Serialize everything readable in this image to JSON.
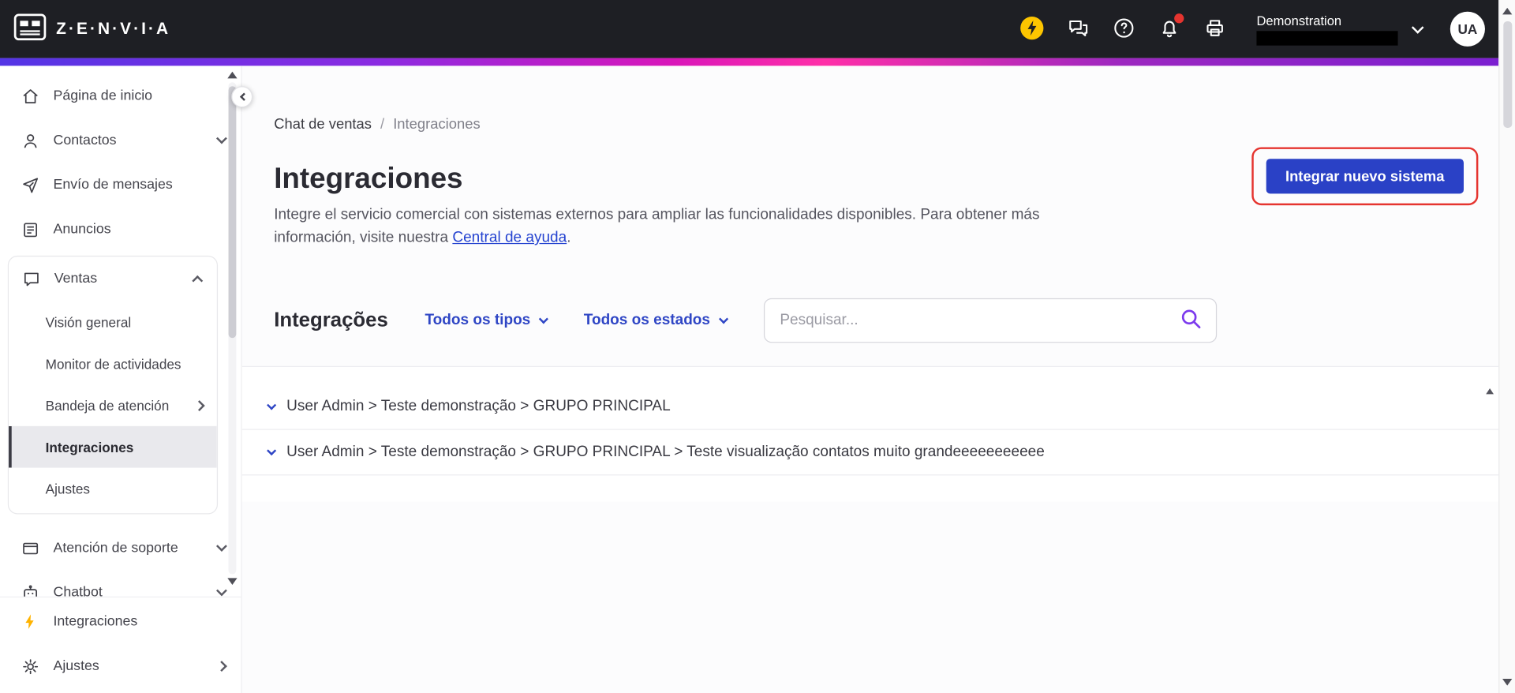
{
  "topbar": {
    "brand": "Z·E·N·V·I·A",
    "account": {
      "name": "Demonstration"
    },
    "avatar_initials": "UA"
  },
  "colors": {
    "topbar_bg": "#1e1f24",
    "accent_blue": "#2a41c6",
    "link_blue": "#2543d0",
    "filter_blue": "#2f46c5",
    "search_purple": "#7c3aed",
    "annotation_red": "#e5342f",
    "notification_red": "#e5342f",
    "flash_yellow": "#fdc500"
  },
  "sidebar": {
    "items": [
      {
        "label": "Página de inicio",
        "icon": "home-icon"
      },
      {
        "label": "Contactos",
        "icon": "contacts-icon",
        "chevron": "down"
      },
      {
        "label": "Envío de mensajes",
        "icon": "send-icon"
      },
      {
        "label": "Anuncios",
        "icon": "announcements-icon"
      },
      {
        "label": "Ventas",
        "icon": "sales-chat-icon",
        "chevron": "up",
        "expanded": true,
        "children": [
          "Visión general",
          "Monitor de actividades",
          "Bandeja de atención",
          "Integraciones",
          "Ajustes"
        ],
        "selected_child": "Integraciones"
      },
      {
        "label": "Atención de soporte",
        "icon": "support-icon",
        "chevron": "down"
      },
      {
        "label": "Chatbot",
        "icon": "chatbot-icon",
        "chevron": "down"
      }
    ],
    "footer": [
      {
        "label": "Integraciones",
        "icon": "flash-icon"
      },
      {
        "label": "Ajustes",
        "icon": "gear-icon",
        "chevron": "right"
      }
    ]
  },
  "breadcrumb": {
    "parent": "Chat de ventas",
    "separator": "/",
    "current": "Integraciones"
  },
  "page": {
    "title": "Integraciones",
    "description_part1": "Integre el servicio comercial con sistemas externos para ampliar las funcionalidades disponibles. Para obtener más información, visite nuestra ",
    "description_link": "Central de ayuda",
    "description_part2": ".",
    "primary_button": "Integrar nuevo sistema"
  },
  "filters": {
    "section_title": "Integrações",
    "type_filter": "Todos os tipos",
    "status_filter": "Todos os estados",
    "search_placeholder": "Pesquisar..."
  },
  "integrations_list": {
    "rows": [
      "User Admin > Teste demonstração > GRUPO PRINCIPAL",
      "User Admin > Teste demonstração > GRUPO PRINCIPAL > Teste visualização contatos muito grandeeeeeeeeeee"
    ]
  }
}
